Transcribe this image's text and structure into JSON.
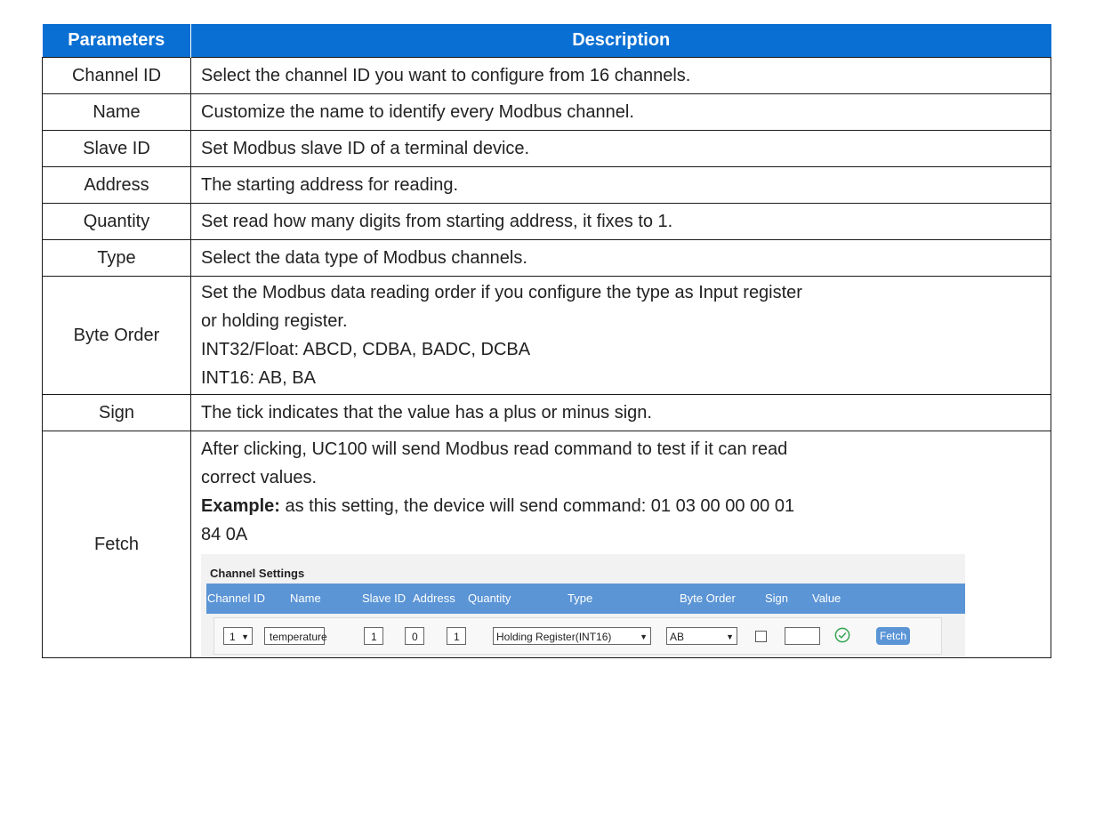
{
  "table": {
    "header": {
      "parameters": "Parameters",
      "description": "Description"
    },
    "rows": [
      {
        "param": "Channel ID",
        "desc": [
          "Select the channel ID you want to configure from 16 channels."
        ]
      },
      {
        "param": "Name",
        "desc": [
          "Customize the name to identify every Modbus channel."
        ]
      },
      {
        "param": "Slave ID",
        "desc": [
          "Set Modbus slave ID of a terminal device."
        ]
      },
      {
        "param": "Address",
        "desc": [
          "The starting address for reading."
        ]
      },
      {
        "param": "Quantity",
        "desc": [
          "Set read how many digits from starting address, it fixes to 1."
        ]
      },
      {
        "param": "Type",
        "desc": [
          "Select the data type of Modbus channels."
        ]
      },
      {
        "param": "Byte Order",
        "desc": [
          "Set the Modbus data reading order if you configure the type as Input register",
          "or holding register.",
          "INT32/Float: ABCD, CDBA, BADC, DCBA",
          "INT16: AB, BA"
        ]
      },
      {
        "param": "Sign",
        "desc": [
          "The tick indicates that the value has a plus or minus sign."
        ]
      },
      {
        "param": "Fetch",
        "desc": [
          "After clicking, UC100 will send Modbus read command to test if it can read",
          "correct values."
        ],
        "example_label": "Example:",
        "example_text_1": " as this setting, the device will send command: 01 03 00 00 00 01",
        "example_text_2": "84 0A"
      }
    ]
  },
  "channel_settings": {
    "title": "Channel Settings",
    "columns": {
      "channel_id": "Channel ID",
      "name": "Name",
      "slave_id": "Slave ID",
      "address": "Address",
      "quantity": "Quantity",
      "type": "Type",
      "byte_order": "Byte Order",
      "sign": "Sign",
      "value": "Value"
    },
    "row": {
      "channel_id": "1",
      "name": "temperature",
      "slave_id": "1",
      "address": "0",
      "quantity": "1",
      "type": "Holding Register(INT16)",
      "byte_order": "AB",
      "sign_checked": false,
      "value": "",
      "fetch_label": "Fetch",
      "status_icon": "check-circle-icon"
    },
    "colors": {
      "header_bar": "#5b95d6",
      "fetch_button": "#5b95d6",
      "status_ok": "#2ea44f"
    }
  },
  "colors": {
    "table_header": "#0a6fd3"
  }
}
